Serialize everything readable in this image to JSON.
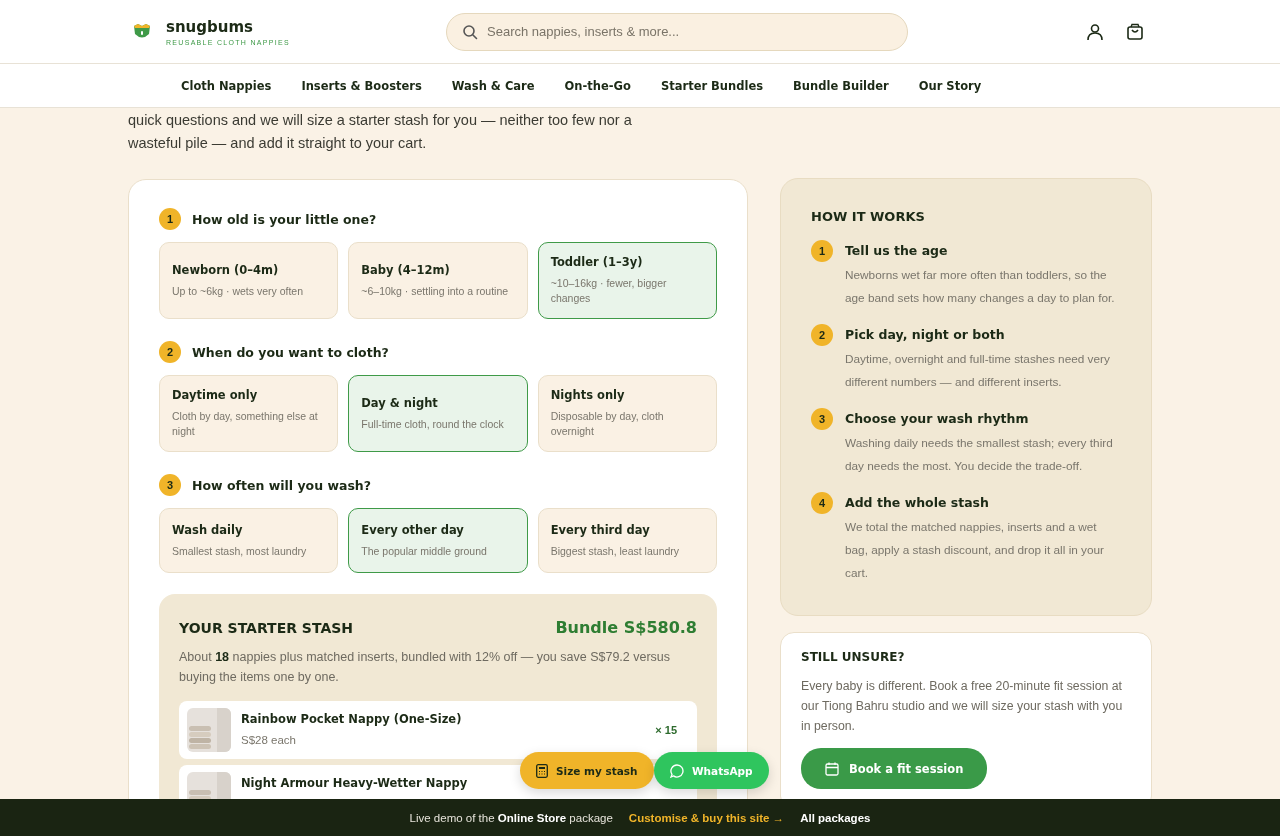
{
  "header": {
    "brand": "snugbums",
    "tagline": "REUSABLE CLOTH NAPPIES",
    "search": {
      "placeholder": "Search nappies, inserts & more..."
    }
  },
  "nav": [
    "Cloth Nappies",
    "Inserts & Boosters",
    "Wash & Care",
    "On-the-Go",
    "Starter Bundles",
    "Bundle Builder",
    "Our Story"
  ],
  "intro": "quick questions and we will size a starter stash for you — neither too few nor a wasteful pile — and add it straight to your cart.",
  "questions": [
    {
      "number": "1",
      "title": "How old is your little one?",
      "options": [
        {
          "label": "Newborn (0–4m)",
          "detail": "Up to ~6kg · wets very often",
          "selected": false
        },
        {
          "label": "Baby (4–12m)",
          "detail": "~6–10kg · settling into a routine",
          "selected": false
        },
        {
          "label": "Toddler (1–3y)",
          "detail": "~10–16kg · fewer, bigger changes",
          "selected": true
        }
      ]
    },
    {
      "number": "2",
      "title": "When do you want to cloth?",
      "options": [
        {
          "label": "Daytime only",
          "detail": "Cloth by day, something else at night",
          "selected": false
        },
        {
          "label": "Day & night",
          "detail": "Full-time cloth, round the clock",
          "selected": true
        },
        {
          "label": "Nights only",
          "detail": "Disposable by day, cloth overnight",
          "selected": false
        }
      ]
    },
    {
      "number": "3",
      "title": "How often will you wash?",
      "options": [
        {
          "label": "Wash daily",
          "detail": "Smallest stash, most laundry",
          "selected": false
        },
        {
          "label": "Every other day",
          "detail": "The popular middle ground",
          "selected": true
        },
        {
          "label": "Every third day",
          "detail": "Biggest stash, least laundry",
          "selected": false
        }
      ]
    }
  ],
  "stash": {
    "title": "YOUR STARTER STASH",
    "total": "Bundle S$580.8",
    "summary": "About **18** nappies plus matched inserts, bundled with 12% off — you save S$79.2 versus buying the items one by one.",
    "items": [
      {
        "name": "Rainbow Pocket Nappy (One-Size)",
        "price": "S$28 each",
        "qty": "× 15"
      },
      {
        "name": "Night Armour Heavy-Wetter Nappy"
      }
    ]
  },
  "how_it_works": {
    "title": "HOW IT WORKS",
    "steps": [
      {
        "number": "1",
        "title": "Tell us the age",
        "text": "Newborns wet far more often than toddlers, so the age band sets how many changes a day to plan for."
      },
      {
        "number": "2",
        "title": "Pick day, night or both",
        "text": "Daytime, overnight and full-time stashes need very different numbers — and different inserts."
      },
      {
        "number": "3",
        "title": "Choose your wash rhythm",
        "text": "Washing daily needs the smallest stash; every third day needs the most. You decide the trade-off."
      },
      {
        "number": "4",
        "title": "Add the whole stash",
        "text": "We total the matched nappies, inserts and a wet bag, apply a stash discount, and drop it all in your cart."
      }
    ]
  },
  "unsure": {
    "title": "STILL UNSURE?",
    "text": "Every baby is different. Book a free 20-minute fit session at our Tiong Bahru studio and we will size your stash with you in person.",
    "button": "Book a fit session"
  },
  "floating": {
    "size_button": "Size my stash",
    "whatsapp_button": "WhatsApp"
  },
  "demo_bar": {
    "text": "Live demo of the **Online Store** package",
    "link": "Customise & buy this site →",
    "all": "All packages"
  }
}
